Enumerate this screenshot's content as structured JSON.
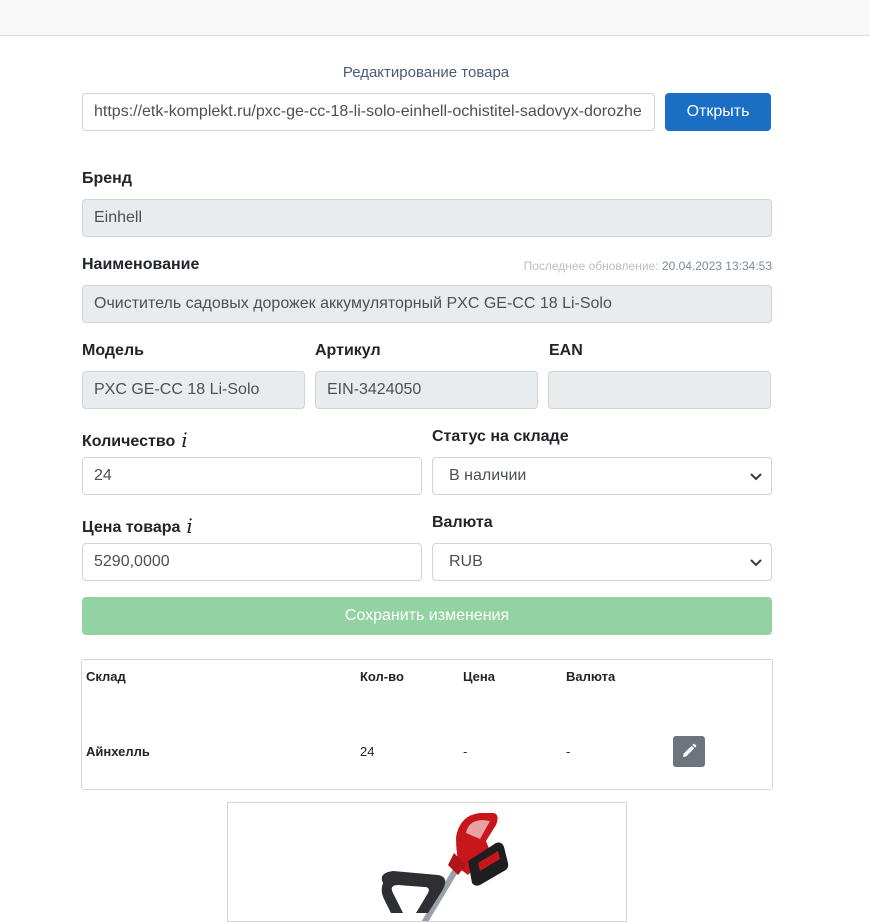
{
  "page": {
    "title": "Редактирование товара"
  },
  "url_bar": {
    "value": "https://etk-komplekt.ru/pxc-ge-cc-18-li-solo-einhell-ochistitel-sadovyx-dorozhe",
    "open_label": "Открыть"
  },
  "form": {
    "brand": {
      "label": "Бренд",
      "value": "Einhell"
    },
    "name": {
      "label": "Наименование",
      "value": "Очиститель садовых дорожек аккумуляторный PXC GE-CC 18 Li-Solo"
    },
    "last_update": {
      "label": "Последнее обновление:",
      "value": "20.04.2023 13:34:53"
    },
    "model": {
      "label": "Модель",
      "value": "PXC GE-CC 18 Li-Solo"
    },
    "article": {
      "label": "Артикул",
      "value": "EIN-3424050"
    },
    "ean": {
      "label": "EAN",
      "value": ""
    },
    "quantity": {
      "label": "Количество",
      "value": "24",
      "info_icon": "info-icon"
    },
    "stock_status": {
      "label": "Статус на складе",
      "selected": "В наличии"
    },
    "price": {
      "label": "Цена товара",
      "value": "5290,0000",
      "info_icon": "info-icon"
    },
    "currency": {
      "label": "Валюта",
      "selected": "RUB"
    },
    "save_label": "Сохранить изменения"
  },
  "warehouse_table": {
    "headers": {
      "warehouse": "Склад",
      "qty": "Кол-во",
      "price": "Цена",
      "currency": "Валюта"
    },
    "rows": [
      {
        "warehouse": "Айнхелль",
        "qty": "24",
        "price": "-",
        "currency": "-",
        "action_icon": "pencil-icon"
      }
    ]
  },
  "colors": {
    "primary_button": "#1a6fc4",
    "save_button_disabled": "#93d3a2",
    "title_text": "#4a5b78",
    "readonly_bg": "#e9ecef"
  }
}
